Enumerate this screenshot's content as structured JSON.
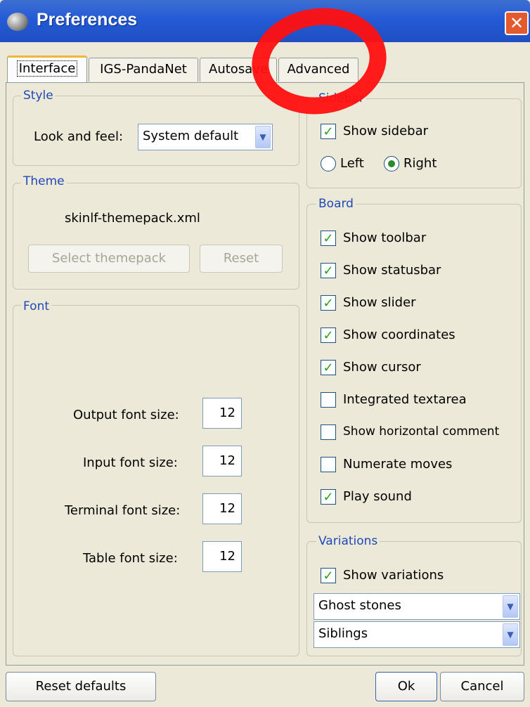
{
  "window": {
    "title": "Preferences",
    "close_glyph": "✕"
  },
  "tabs": [
    {
      "label": "Interface",
      "active": true
    },
    {
      "label": "IGS-PandaNet",
      "active": false
    },
    {
      "label": "Autosave",
      "active": false
    },
    {
      "label": "Advanced",
      "active": false
    }
  ],
  "style_group": {
    "title": "Style",
    "look_and_feel_label": "Look and feel:",
    "look_and_feel_value": "System default"
  },
  "theme_group": {
    "title": "Theme",
    "file": "skinlf-themepack.xml",
    "select_button": "Select themepack",
    "reset_button": "Reset"
  },
  "font_group": {
    "title": "Font",
    "rows": [
      {
        "label": "Output font size:",
        "value": "12"
      },
      {
        "label": "Input font size:",
        "value": "12"
      },
      {
        "label": "Terminal font size:",
        "value": "12"
      },
      {
        "label": "Table font size:",
        "value": "12"
      }
    ]
  },
  "sidebar_group": {
    "title": "Sidebar",
    "show_sidebar": {
      "label": "Show sidebar",
      "checked": true
    },
    "left_label": "Left",
    "right_label": "Right",
    "selected_side": "Right"
  },
  "board_group": {
    "title": "Board",
    "options": [
      {
        "label": "Show toolbar",
        "checked": true
      },
      {
        "label": "Show statusbar",
        "checked": true
      },
      {
        "label": "Show slider",
        "checked": true
      },
      {
        "label": "Show coordinates",
        "checked": true
      },
      {
        "label": "Show cursor",
        "checked": true
      },
      {
        "label": "Integrated textarea",
        "checked": false
      },
      {
        "label": "Show horizontal comment",
        "checked": false
      },
      {
        "label": "Numerate moves",
        "checked": false
      },
      {
        "label": "Play sound",
        "checked": true
      }
    ]
  },
  "variations_group": {
    "title": "Variations",
    "show_variations": {
      "label": "Show variations",
      "checked": true
    },
    "mode_select": "Ghost stones",
    "scope_select": "Siblings"
  },
  "footer": {
    "reset_defaults": "Reset defaults",
    "ok": "Ok",
    "cancel": "Cancel"
  },
  "colors": {
    "title_bar": "#245ad6",
    "group_title": "#1f49b8",
    "annotation_circle": "#ff1010",
    "check_mark": "#21a121"
  },
  "icons": {
    "check": "✓",
    "dropdown": "▼"
  }
}
